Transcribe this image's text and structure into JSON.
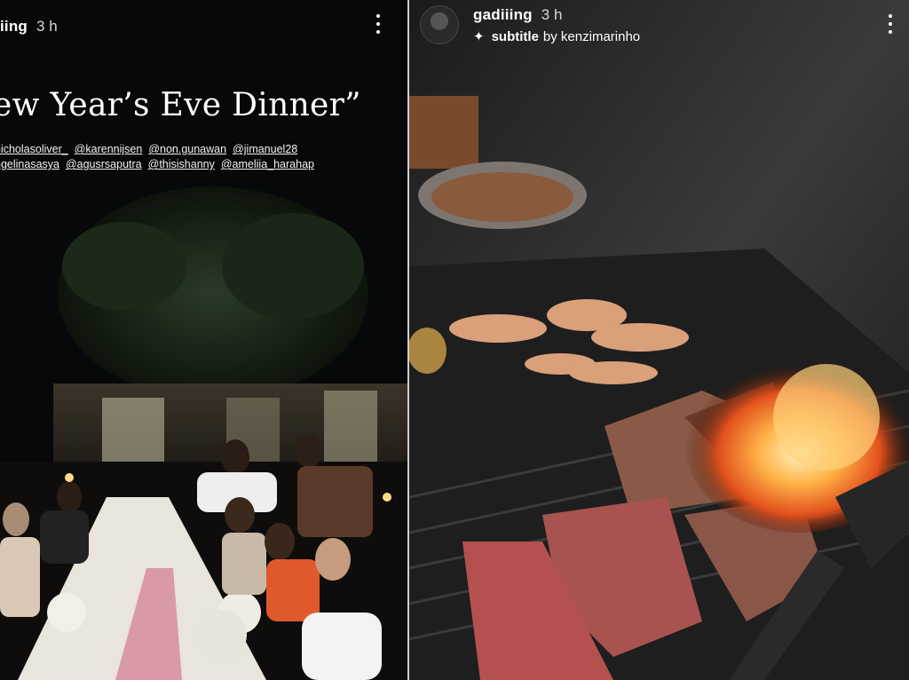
{
  "left_story": {
    "username": "iing",
    "age": "3 h",
    "title": "ew Year’s Eve Dinner”",
    "mentions_line1": [
      "nicholasoliver_",
      "@karennijsen",
      "@non.gunawan",
      "@jimanuel28"
    ],
    "mentions_line2": [
      "ngelinasasya",
      "@agusrsaputra",
      "@thisishanny",
      "@ameliia_harahap"
    ]
  },
  "right_story": {
    "username": "gadiiing",
    "age": "3 h",
    "subtitle_label": "subtitle",
    "subtitle_by": "by kenzimarinho"
  }
}
